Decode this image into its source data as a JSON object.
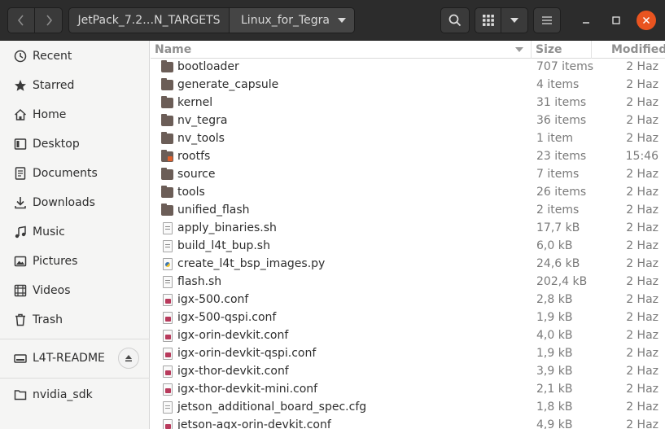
{
  "header": {
    "breadcrumbs": [
      "JetPack_7.2…N_TARGETS",
      "Linux_for_Tegra"
    ]
  },
  "sidebar": {
    "items": [
      {
        "label": "Recent",
        "icon": "clock-icon"
      },
      {
        "label": "Starred",
        "icon": "star-icon"
      },
      {
        "label": "Home",
        "icon": "home-icon"
      },
      {
        "label": "Desktop",
        "icon": "desktop-icon"
      },
      {
        "label": "Documents",
        "icon": "documents-icon"
      },
      {
        "label": "Downloads",
        "icon": "download-icon"
      },
      {
        "label": "Music",
        "icon": "music-icon"
      },
      {
        "label": "Pictures",
        "icon": "pictures-icon"
      },
      {
        "label": "Videos",
        "icon": "videos-icon"
      },
      {
        "label": "Trash",
        "icon": "trash-icon"
      }
    ],
    "devices": [
      {
        "label": "L4T-README",
        "icon": "drive-icon"
      },
      {
        "label": "nvidia_sdk",
        "icon": "folder-icon"
      }
    ]
  },
  "columns": {
    "name": "Name",
    "size": "Size",
    "modified": "Modified"
  },
  "files": [
    {
      "name": "bootloader",
      "size": "707 items",
      "modified": "2 Haz",
      "type": "folder"
    },
    {
      "name": "generate_capsule",
      "size": "4 items",
      "modified": "2 Haz",
      "type": "folder"
    },
    {
      "name": "kernel",
      "size": "31 items",
      "modified": "2 Haz",
      "type": "folder"
    },
    {
      "name": "nv_tegra",
      "size": "36 items",
      "modified": "2 Haz",
      "type": "folder"
    },
    {
      "name": "nv_tools",
      "size": "1 item",
      "modified": "2 Haz",
      "type": "folder"
    },
    {
      "name": "rootfs",
      "size": "23 items",
      "modified": "15:46",
      "type": "folder-locked"
    },
    {
      "name": "source",
      "size": "7 items",
      "modified": "2 Haz",
      "type": "folder"
    },
    {
      "name": "tools",
      "size": "26 items",
      "modified": "2 Haz",
      "type": "folder"
    },
    {
      "name": "unified_flash",
      "size": "2 items",
      "modified": "2 Haz",
      "type": "folder"
    },
    {
      "name": "apply_binaries.sh",
      "size": "17,7 kB",
      "modified": "2 Haz",
      "type": "sh"
    },
    {
      "name": "build_l4t_bup.sh",
      "size": "6,0 kB",
      "modified": "2 Haz",
      "type": "sh"
    },
    {
      "name": "create_l4t_bsp_images.py",
      "size": "24,6 kB",
      "modified": "2 Haz",
      "type": "py"
    },
    {
      "name": "flash.sh",
      "size": "202,4 kB",
      "modified": "2 Haz",
      "type": "sh"
    },
    {
      "name": "igx-500.conf",
      "size": "2,8 kB",
      "modified": "2 Haz",
      "type": "conf"
    },
    {
      "name": "igx-500-qspi.conf",
      "size": "1,9 kB",
      "modified": "2 Haz",
      "type": "conf"
    },
    {
      "name": "igx-orin-devkit.conf",
      "size": "4,0 kB",
      "modified": "2 Haz",
      "type": "conf"
    },
    {
      "name": "igx-orin-devkit-qspi.conf",
      "size": "1,9 kB",
      "modified": "2 Haz",
      "type": "conf"
    },
    {
      "name": "igx-thor-devkit.conf",
      "size": "3,9 kB",
      "modified": "2 Haz",
      "type": "conf"
    },
    {
      "name": "igx-thor-devkit-mini.conf",
      "size": "2,1 kB",
      "modified": "2 Haz",
      "type": "conf"
    },
    {
      "name": "jetson_additional_board_spec.cfg",
      "size": "1,8 kB",
      "modified": "2 Haz",
      "type": "cfg"
    },
    {
      "name": "jetson-agx-orin-devkit.conf",
      "size": "4,9 kB",
      "modified": "2 Haz",
      "type": "conf"
    }
  ]
}
